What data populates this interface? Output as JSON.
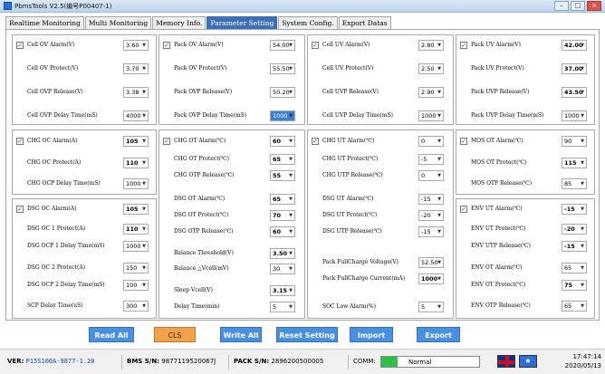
{
  "window": {
    "title": "PbmsTools V2.5(编号P00407-1)"
  },
  "tabs": [
    "Realtime Monitoring",
    "Multi Monitoring",
    "Memory Info.",
    "Parameter Setting",
    "System Config.",
    "Export Datas"
  ],
  "active_tab": "Parameter Setting",
  "groups": {
    "cell_ov": [
      {
        "label": "Cell OV Alarm(V)",
        "value": "3.60",
        "checkbox": true
      },
      {
        "label": "Cell OV Protect(V)",
        "value": "3.70"
      },
      {
        "label": "Cell OVP Release(V)",
        "value": "3.38"
      },
      {
        "label": "Cell OVP Delay Time(mS)",
        "value": "4000"
      }
    ],
    "pack_ov": [
      {
        "label": "Pack OV Alarm(V)",
        "value": "54.00",
        "checkbox": true
      },
      {
        "label": "Pack OV Protect(V)",
        "value": "55.50"
      },
      {
        "label": "Pack OVP Release(V)",
        "value": "50.20"
      },
      {
        "label": "Pack OVP Delay Time(mS)",
        "value": "1000",
        "highlight": true
      }
    ],
    "cell_uv": [
      {
        "label": "Cell UV Alarm(V)",
        "value": "2.80",
        "checkbox": true
      },
      {
        "label": "Cell UV Protect(V)",
        "value": "2.50"
      },
      {
        "label": "Cell UVP Release(V)",
        "value": "2.90"
      },
      {
        "label": "Cell UVP Delay Time(mS)",
        "value": "1000"
      }
    ],
    "pack_uv": [
      {
        "label": "Pack UV Alarm(V)",
        "value": "42.00",
        "checkbox": true,
        "bold": true
      },
      {
        "label": "Pack UV Protect(V)",
        "value": "37.00",
        "bold": true
      },
      {
        "label": "Pack UVP Release(V)",
        "value": "43.50",
        "bold": true
      },
      {
        "label": "Pack UVP Delay Time(mS)",
        "value": "1000"
      }
    ],
    "chg_oc": [
      {
        "label": "CHG OC Alarm(A)",
        "value": "105",
        "checkbox": true,
        "bold": true
      },
      {
        "label": "CHG OC Protect(A)",
        "value": "110",
        "bold": true
      },
      {
        "label": "CHG OCP Delay Time(mS)",
        "value": "1000"
      }
    ],
    "dsg_oc": [
      {
        "label": "DSG OC Alarm(A)",
        "value": "105",
        "checkbox": true,
        "bold": true
      },
      {
        "label": "DSG OC 1 Protect(A)",
        "value": "110",
        "bold": true
      },
      {
        "label": "DSG OCP 1 Delay Time(mS)",
        "value": "1000"
      },
      {
        "label": "DSG OC 2 Protect(A)",
        "value": "150"
      },
      {
        "label": "DSG OCP 2 Delay Time(mS)",
        "value": "100"
      },
      {
        "label": "SCP Delay Time(uS)",
        "value": "300"
      }
    ],
    "chg_ot": [
      {
        "label": "CHG OT Alarm(℃)",
        "value": "60",
        "checkbox": true,
        "bold": true
      },
      {
        "label": "CHG OT Protect(℃)",
        "value": "65",
        "bold": true
      },
      {
        "label": "CHG OTP Release(℃)",
        "value": "55",
        "bold": true
      },
      {
        "label": "DSG OT Alarm(℃)",
        "value": "65",
        "bold": true
      },
      {
        "label": "DSG OT Protect(℃)",
        "value": "70",
        "bold": true
      },
      {
        "label": "DSG OTP Release(℃)",
        "value": "60",
        "bold": true
      },
      {
        "label": "Balance Threshold(V)",
        "value": "3.50",
        "bold": true
      },
      {
        "label": "Balance △Vcell(mV)",
        "value": "30"
      },
      {
        "label": "Sleep Vcell(V)",
        "value": "3.15",
        "bold": true
      },
      {
        "label": "Delay Time(min)",
        "value": "5"
      }
    ],
    "chg_ut": [
      {
        "label": "CHG UT Alarm(℃)",
        "value": "0",
        "checkbox": true
      },
      {
        "label": "CHG UT Protect(℃)",
        "value": "-5"
      },
      {
        "label": "CHG UTP Release(℃)",
        "value": "0"
      },
      {
        "label": "DSG UT Alarm(℃)",
        "value": "-15"
      },
      {
        "label": "DSG UT Protect(℃)",
        "value": "-20"
      },
      {
        "label": "DSG UTP Release(℃)",
        "value": "-15"
      },
      {
        "label": "Pack FullCharge Voltage(V)",
        "value": "52.50"
      },
      {
        "label": "Pack FullCharge Current(mA)",
        "value": "1000",
        "bold": true
      },
      {
        "label": "SOC Low Alarm(%)",
        "value": "5"
      }
    ],
    "mos_ot": [
      {
        "label": "MOS OT Alarm(℃)",
        "value": "90",
        "checkbox": true
      },
      {
        "label": "MOS OT Protect(℃)",
        "value": "115",
        "bold": true
      },
      {
        "label": "MOS OTP Release(℃)",
        "value": "85"
      }
    ],
    "env_ut": [
      {
        "label": "ENV UT Alarm(℃)",
        "value": "-15",
        "checkbox": true,
        "bold": true
      },
      {
        "label": "ENV UT Protect(℃)",
        "value": "-20",
        "bold": true
      },
      {
        "label": "ENV UTP Release(℃)",
        "value": "-15",
        "bold": true
      },
      {
        "label": "ENV OT Alarm(℃)",
        "value": "65"
      },
      {
        "label": "ENV OT Protect(℃)",
        "value": "75",
        "bold": true
      },
      {
        "label": "ENV OTP Release(℃)",
        "value": "65"
      }
    ]
  },
  "buttons": {
    "read_all": "Read All",
    "cls": "CLS",
    "write_all": "Write All",
    "reset_setting": "Reset Setting",
    "import": "Import",
    "export": "Export"
  },
  "status": {
    "ver_label": "VER:",
    "ver_value": "P15S100A-9877-1.20",
    "bms_label": "BMS S/N:",
    "bms_value": "9877119520067J",
    "pack_label": "PACK S/N:",
    "pack_value": "2896200500005",
    "comm_label": "COMM:",
    "comm_state": "Normal",
    "time": "17:47:14",
    "date": "2020/05/13"
  },
  "colors": {
    "accent": "#3d6fb8",
    "button": "#4a90e2",
    "cls_button": "#f0a14a",
    "comm_ok": "#2ec04a"
  },
  "icons": [
    "app-icon",
    "uk-flag-icon",
    "cn-flag-icon",
    "chevron-down-icon"
  ]
}
